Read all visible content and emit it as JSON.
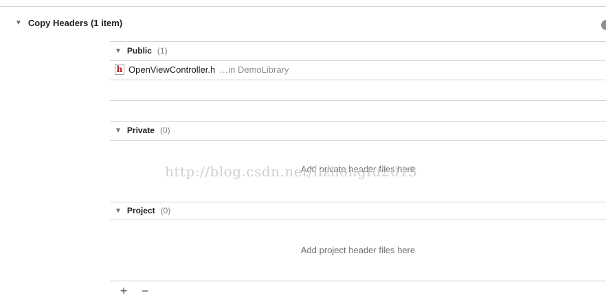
{
  "phase": {
    "title": "Copy Headers (1 item)",
    "disclosure_icon": "triangle-down"
  },
  "sections": {
    "public": {
      "name": "Public",
      "count": "(1)",
      "files": [
        {
          "name": "OpenViewController.h",
          "location": "…in DemoLibrary",
          "icon_letter": "h"
        }
      ]
    },
    "private": {
      "name": "Private",
      "count": "(0)",
      "placeholder": "Add private header files here"
    },
    "project": {
      "name": "Project",
      "count": "(0)",
      "placeholder": "Add project header files here"
    }
  },
  "watermark": "http://blog.csdn.net/lizhongfu2013",
  "toolbar": {
    "add_label": "+",
    "remove_label": "−"
  },
  "colors": {
    "file_icon_letter": "#b3202a",
    "divider": "#d3d3d3"
  }
}
